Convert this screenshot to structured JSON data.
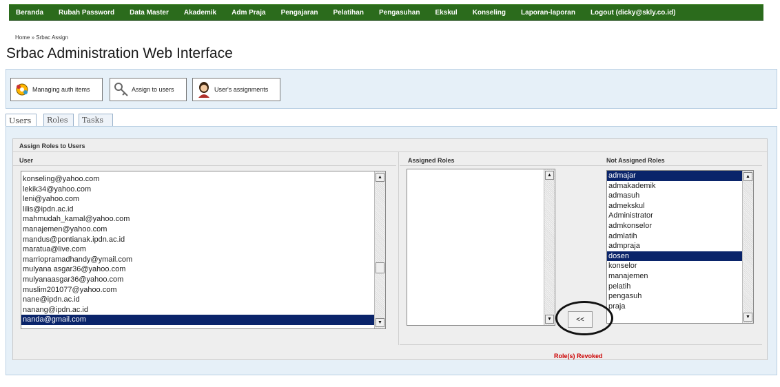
{
  "nav": {
    "items": [
      "Beranda",
      "Rubah Password",
      "Data Master",
      "Akademik",
      "Adm Praja",
      "Pengajaran",
      "Pelatihan",
      "Pengasuhan",
      "Ekskul",
      "Konseling",
      "Laporan-laporan",
      "Logout (dicky@skly.co.id)"
    ]
  },
  "breadcrumb": {
    "home": "Home",
    "separator": "»",
    "current": "Srbac Assign"
  },
  "page": {
    "title": "Srbac Administration Web Interface"
  },
  "toolbar": {
    "manage_label": "Managing auth items",
    "assign_label": "Assign to users",
    "assignments_label": "User's assignments"
  },
  "tabs": [
    {
      "label": "Users",
      "active": true
    },
    {
      "label": "Roles",
      "active": false
    },
    {
      "label": "Tasks",
      "active": false
    }
  ],
  "section": {
    "title": "Assign Roles to Users",
    "user_header": "User",
    "assigned_header": "Assigned Roles",
    "not_assigned_header": "Not Assigned Roles"
  },
  "users": [
    {
      "email": "konseling@yahoo.com",
      "selected": false
    },
    {
      "email": "lekik34@yahoo.com",
      "selected": false
    },
    {
      "email": "leni@yahoo.com",
      "selected": false
    },
    {
      "email": "lilis@ipdn.ac.id",
      "selected": false
    },
    {
      "email": "mahmudah_kamal@yahoo.com",
      "selected": false
    },
    {
      "email": "manajemen@yahoo.com",
      "selected": false
    },
    {
      "email": "mandus@pontianak.ipdn.ac.id",
      "selected": false
    },
    {
      "email": "maratua@live.com",
      "selected": false
    },
    {
      "email": "marriopramadhandy@ymail.com",
      "selected": false
    },
    {
      "email": "mulyana asgar36@yahoo.com",
      "selected": false
    },
    {
      "email": "mulyanaasgar36@yahoo.com",
      "selected": false
    },
    {
      "email": "muslim201077@yahoo.com",
      "selected": false
    },
    {
      "email": "nane@ipdn.ac.id",
      "selected": false
    },
    {
      "email": "nanang@ipdn.ac.id",
      "selected": false
    },
    {
      "email": "nanda@gmail.com",
      "selected": true
    }
  ],
  "assigned_roles": [],
  "not_assigned_roles": [
    {
      "name": "admajar",
      "selected": true
    },
    {
      "name": "admakademik",
      "selected": false
    },
    {
      "name": "admasuh",
      "selected": false
    },
    {
      "name": "admekskul",
      "selected": false
    },
    {
      "name": "Administrator",
      "selected": false
    },
    {
      "name": "admkonselor",
      "selected": false
    },
    {
      "name": "admlatih",
      "selected": false
    },
    {
      "name": "admpraja",
      "selected": false
    },
    {
      "name": "dosen",
      "selected": true
    },
    {
      "name": "konselor",
      "selected": false
    },
    {
      "name": "manajemen",
      "selected": false
    },
    {
      "name": "pelatih",
      "selected": false
    },
    {
      "name": "pengasuh",
      "selected": false
    },
    {
      "name": "praja",
      "selected": false
    }
  ],
  "revoke_button": "<<",
  "status": "Role(s) Revoked",
  "colors": {
    "nav_bg": "#2b6b1c",
    "selection": "#0a246a",
    "status": "#cc0000"
  }
}
